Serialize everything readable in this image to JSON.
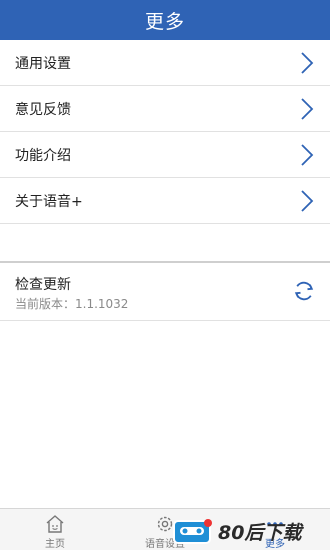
{
  "header": {
    "title": "更多"
  },
  "menu": {
    "items": [
      {
        "label": "通用设置"
      },
      {
        "label": "意见反馈"
      },
      {
        "label": "功能介绍"
      },
      {
        "label": "关于语音+"
      }
    ]
  },
  "update": {
    "title": "检查更新",
    "version_text": "当前版本：1.1.1032"
  },
  "tabbar": {
    "tabs": [
      {
        "label": "主页",
        "icon": "home-icon"
      },
      {
        "label": "语音设置",
        "icon": "gear-icon"
      },
      {
        "label": "更多",
        "icon": "more-icon",
        "active": true
      }
    ]
  },
  "watermark": {
    "text": "80后下载"
  },
  "colors": {
    "accent": "#2f63b5",
    "header_bg": "#2f63b5",
    "divider": "#e1e1e1",
    "text_primary": "#222222",
    "text_secondary": "#8a8a8a",
    "tabbar_bg": "#f5f5f5"
  }
}
